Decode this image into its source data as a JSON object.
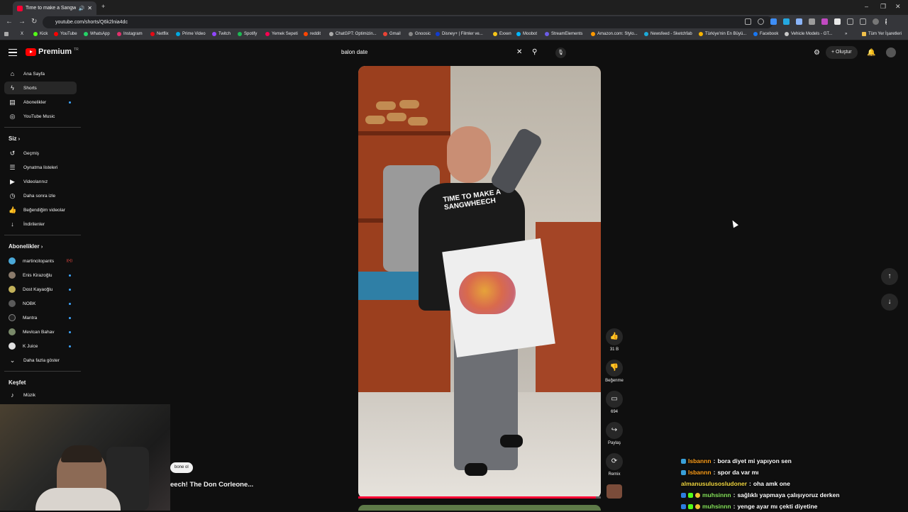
{
  "browser": {
    "tab_title": "Time to make a Sangwhee",
    "url": "youtube.com/shorts/Q6k2lnia4dc",
    "bookmarks": [
      "Kick",
      "YouTube",
      "WhatsApp",
      "Instagram",
      "Netflix",
      "Prime Video",
      "Twitch",
      "Spotify",
      "Yemek Sepeti",
      "reddit",
      "ChatGPT: Optimizin...",
      "Gmail",
      "Gnoosic",
      "Disney+ | Filmler ve...",
      "Exxen",
      "Moobot",
      "StreamElements",
      "Amazon.com: Stylo...",
      "Newsfeed - Sketchfab",
      "Türkiye'nin En Büyü...",
      "Facebook",
      "Vehicle Models - GT..."
    ],
    "bookmarks_all": "Tüm Yer İşaretleri"
  },
  "header": {
    "logo_text": "Premium",
    "logo_sup": "TR",
    "search_value": "balon date",
    "create_label": "Oluştur"
  },
  "sidebar": {
    "main": [
      {
        "label": "Ana Sayfa",
        "icon": "home-icon"
      },
      {
        "label": "Shorts",
        "icon": "shorts-icon"
      },
      {
        "label": "Abonelikler",
        "icon": "subscriptions-icon"
      },
      {
        "label": "YouTube Music",
        "icon": "music-icon"
      }
    ],
    "you_title": "Siz",
    "you": [
      {
        "label": "Geçmiş",
        "icon": "history-icon"
      },
      {
        "label": "Oynatma listeleri",
        "icon": "playlist-icon"
      },
      {
        "label": "Videolarınız",
        "icon": "video-icon"
      },
      {
        "label": "Daha sonra izle",
        "icon": "clock-icon"
      },
      {
        "label": "Beğendiğim videolar",
        "icon": "like-icon"
      },
      {
        "label": "İndirilenler",
        "icon": "download-icon"
      }
    ],
    "subs_title": "Abonelikler",
    "subs": [
      {
        "label": "martincitopants",
        "color": "#4aa8d8",
        "live": true
      },
      {
        "label": "Enis Kirazoğlu",
        "color": "#8a7a6a",
        "live": false
      },
      {
        "label": "Dost Kayaoğlu",
        "color": "#c2b15a",
        "live": false
      },
      {
        "label": "NOBK",
        "color": "#5a5a5a",
        "live": false
      },
      {
        "label": "Mantra",
        "color": "#222222",
        "live": false
      },
      {
        "label": "Mevlcan Bahav",
        "color": "#7a8a6a",
        "live": false
      },
      {
        "label": "K Juice",
        "color": "#e0e0e0",
        "live": false
      }
    ],
    "show_more": "Daha fazla göster",
    "explore_title": "Keşfet",
    "explore": [
      {
        "label": "Müzik",
        "icon": "music-note-icon"
      }
    ]
  },
  "video": {
    "shirt_line1": "TIME TO MAKE A",
    "shirt_line2": "SANGWHEECH",
    "subscribe_label": "bone ol",
    "title": "eech! The Don Corleone...",
    "progress": 0.98
  },
  "actions": {
    "likes": "31 B",
    "dislike_label": "Beğenme",
    "comments": "694",
    "share_label": "Paylaş",
    "remix_label": "Remix"
  },
  "chat": [
    {
      "user": "lsbannn",
      "text": "bora diyet mi yapıyon sen",
      "color": "orange"
    },
    {
      "user": "lsbannn",
      "text": "spor da var mı",
      "color": "orange"
    },
    {
      "user": "almanusulusosludoner",
      "text": "oha amk one",
      "color": "yellow"
    },
    {
      "user": "muhsinnn",
      "text": "sağlıklı yapmaya çalışıyoruz derken",
      "color": "green"
    },
    {
      "user": "muhsinnn",
      "text": "yenge ayar mı çekti diyetine",
      "color": "green"
    }
  ],
  "colors": {
    "brand_red": "#ff0000",
    "background": "#0f0f0f",
    "chip": "#272727"
  }
}
